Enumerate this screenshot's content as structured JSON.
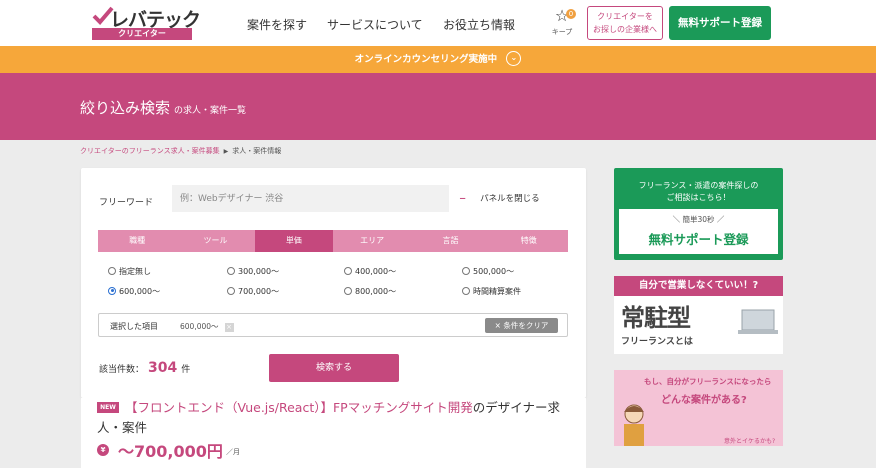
{
  "header": {
    "logo_text": "レバテック",
    "logo_sub": "クリエイター",
    "nav": [
      "案件を探す",
      "サービスについて",
      "お役立ち情報"
    ],
    "keep_label": "キープ",
    "keep_count": "0",
    "company_button": [
      "クリエイターを",
      "お探しの企業様へ"
    ],
    "register_button": "無料サポート登録"
  },
  "banner": {
    "text": "オンラインカウンセリング実施中"
  },
  "hero": {
    "title": "絞り込み検索",
    "subtitle": "の求人・案件一覧"
  },
  "breadcrumb": {
    "link": "クリエイターのフリーランス求人・案件募集",
    "current": "求人・案件情報"
  },
  "search": {
    "freeword_label": "フリーワード",
    "freeword_placeholder": "例：Webデザイナー 渋谷",
    "close_panel": "パネルを閉じる",
    "tabs": [
      "職種",
      "ツール",
      "単価",
      "エリア",
      "言語",
      "特徴"
    ],
    "active_tab": "単価",
    "price_options": [
      "指定無し",
      "300,000〜",
      "400,000〜",
      "500,000〜",
      "600,000〜",
      "700,000〜",
      "800,000〜",
      "時間精算案件"
    ],
    "selected_option": "600,000〜",
    "selected_label": "選択した項目",
    "selected_value": "600,000〜",
    "clear_button": "× 条件をクリア",
    "count_label": "該当件数：",
    "count": "304",
    "count_unit": "件",
    "search_button": "検索する"
  },
  "job": {
    "badge": "NEW",
    "title_link": "【フロントエンド（Vue.js/React）】FPマッチングサイト開発",
    "title_rest": "のデザイナー求人・案件",
    "price_icon": "¥",
    "price": "〜700,000円",
    "unit": "／月"
  },
  "sidebar": {
    "green_text": [
      "フリーランス・派遣の案件探しの",
      "ご相談はこちら！"
    ],
    "green_small": "＼ 簡単30秒 ／",
    "green_big": "無料サポート登録",
    "resident_head": "自分で営業しなくていい！?",
    "resident_big": "常駐型",
    "resident_small": "フリーランスとは",
    "freelance_line1": "もし、自分がフリーランスになったら",
    "freelance_line2": "どんな案件がある?",
    "freelance_line3": "意外とイケるかも?"
  },
  "colors": {
    "brand_pink": "#c5487d",
    "tab_pink": "#e28caf",
    "banner_orange": "#f6a73a",
    "cta_green": "#1b9a58"
  }
}
